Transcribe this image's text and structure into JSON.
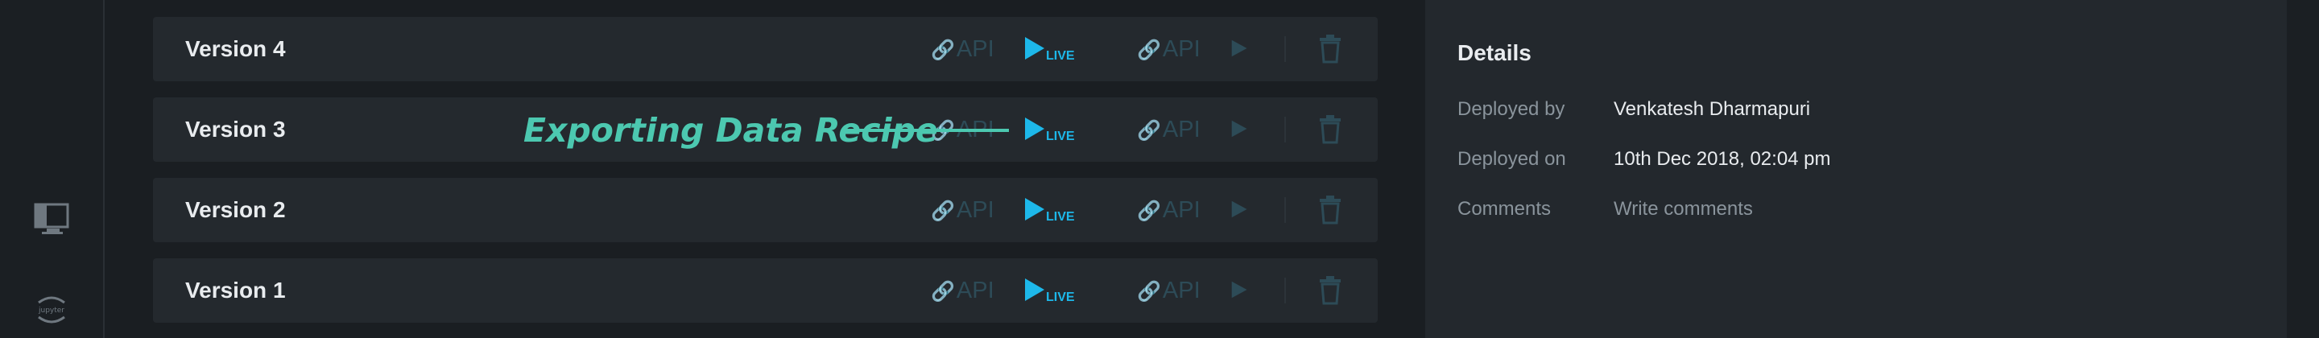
{
  "sidebar": {
    "items": [
      {
        "icon": "desktop-icon"
      },
      {
        "icon": "jupyter-icon",
        "label": "jupyter"
      }
    ]
  },
  "versions": [
    {
      "label": "Version 4",
      "api_left": "API",
      "live": "LIVE",
      "api_right": "API"
    },
    {
      "label": "Version 3",
      "api_left": "API",
      "live": "LIVE",
      "api_right": "API"
    },
    {
      "label": "Version 2",
      "api_left": "API",
      "live": "LIVE",
      "api_right": "API"
    },
    {
      "label": "Version 1",
      "api_left": "API",
      "live": "LIVE",
      "api_right": "API"
    }
  ],
  "annotation": {
    "text": "Exporting Data Recipe"
  },
  "details": {
    "title": "Details",
    "deployed_by_label": "Deployed by",
    "deployed_by_value": "Venkatesh Dharmapuri",
    "deployed_on_label": "Deployed on",
    "deployed_on_value": "10th Dec 2018, 02:04 pm",
    "comments_label": "Comments",
    "comments_placeholder": "Write comments"
  },
  "colors": {
    "accent_live": "#1db8ea",
    "annotation": "#4cc8b0",
    "muted_icon": "#2d4b57"
  }
}
